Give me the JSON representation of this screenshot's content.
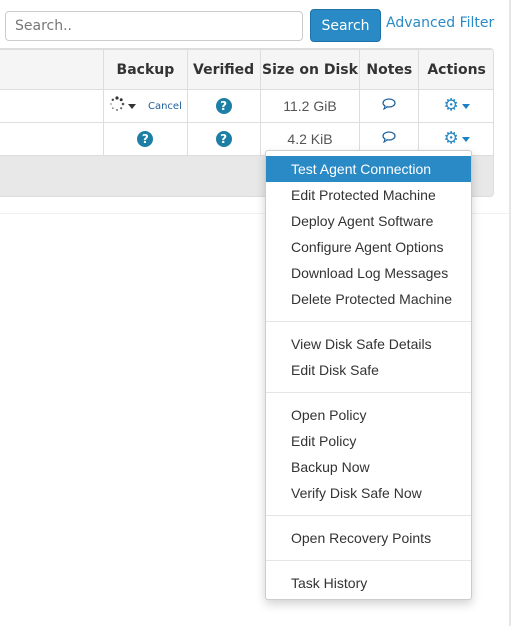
{
  "search": {
    "placeholder": "Search..",
    "value": "",
    "button_label": "Search",
    "advanced_filter_label": "Advanced Filter"
  },
  "table": {
    "columns": [
      "",
      "Backup",
      "Verified",
      "Size on Disk",
      "Notes",
      "Actions"
    ],
    "rows": [
      {
        "backup": {
          "status": "in-progress",
          "icon": "spinner-icon",
          "cancel_label": "Cancel"
        },
        "verified": {
          "icon": "question-circle-icon",
          "glyph": "?"
        },
        "size_on_disk": "11.2 GiB",
        "notes_icon": "comment-icon",
        "actions_icon": "gear-icon"
      },
      {
        "backup": {
          "status": "unknown",
          "icon": "question-circle-icon",
          "glyph": "?"
        },
        "verified": {
          "icon": "question-circle-icon",
          "glyph": "?"
        },
        "size_on_disk": "4.2 KiB",
        "notes_icon": "comment-icon",
        "actions_icon": "gear-icon"
      }
    ]
  },
  "actions_menu": {
    "groups": [
      [
        "Test Agent Connection",
        "Edit Protected Machine",
        "Deploy Agent Software",
        "Configure Agent Options",
        "Download Log Messages",
        "Delete Protected Machine"
      ],
      [
        "View Disk Safe Details",
        "Edit Disk Safe"
      ],
      [
        "Open Policy",
        "Edit Policy",
        "Backup Now",
        "Verify Disk Safe Now"
      ],
      [
        "Open Recovery Points"
      ],
      [
        "Task History"
      ]
    ],
    "highlighted": "Test Agent Connection"
  },
  "colors": {
    "accent": "#2a8ac6",
    "icon_teal": "#1d7fa6"
  }
}
